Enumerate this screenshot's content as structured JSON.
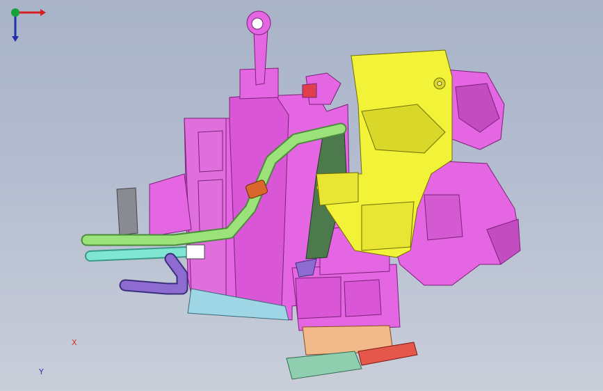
{
  "viewport": {
    "background_top": "#a9b3c8",
    "background_bottom": "#c9ced9"
  },
  "model": {
    "part_colors": {
      "housing": "#e566e2",
      "housing_dark": "#b93db6",
      "duct": "#f2f238",
      "duct_shade": "#c6c420",
      "pipe_green": "#9be27a",
      "pipe_cyan": "#7fe6d3",
      "pipe_purple": "#8d6bd1",
      "dark_green": "#4d7a4d",
      "orange_clip": "#d9662a",
      "flange_peach": "#f2b98a",
      "flange_red": "#e4574a",
      "flange_teal": "#8fcfb0"
    }
  },
  "triad": {
    "x_label": "X",
    "y_label": "Y",
    "x_color": "#d62020",
    "y_color": "#1e2fa8",
    "z_color": "#18a33a"
  }
}
